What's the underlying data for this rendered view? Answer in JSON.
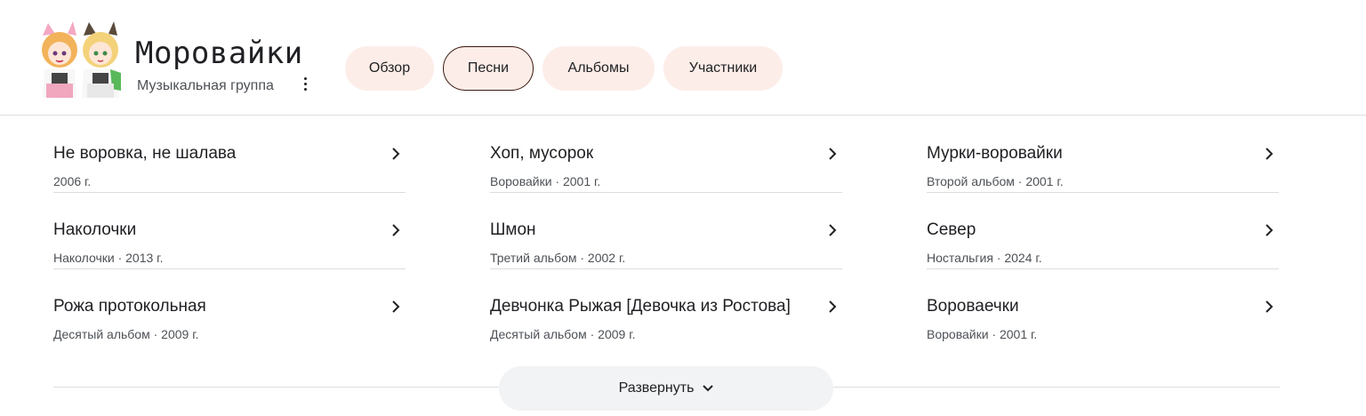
{
  "header": {
    "title": "Моровайки",
    "subtitle": "Музыкальная группа",
    "avatar_icon": "anime-duo-avatar"
  },
  "tabs": [
    {
      "label": "Обзор",
      "active": false
    },
    {
      "label": "Песни",
      "active": true
    },
    {
      "label": "Альбомы",
      "active": false
    },
    {
      "label": "Участники",
      "active": false
    }
  ],
  "songs": [
    {
      "title": "Не воровка, не шалава",
      "subtitle": "2006 г."
    },
    {
      "title": "Хоп, мусорок",
      "subtitle": "Воровайки · 2001 г."
    },
    {
      "title": "Мурки-воровайки",
      "subtitle": "Второй альбом · 2001 г."
    },
    {
      "title": "Наколочки",
      "subtitle": "Наколочки · 2013 г."
    },
    {
      "title": "Шмон",
      "subtitle": "Третий альбом · 2002 г."
    },
    {
      "title": "Север",
      "subtitle": "Ностальгия · 2024 г."
    },
    {
      "title": "Рожа протокольная",
      "subtitle": "Десятый альбом · 2009 г."
    },
    {
      "title": "Девчонка Рыжая [Девочка из Ростова]",
      "subtitle": "Десятый альбом · 2009 г."
    },
    {
      "title": "Вороваечки",
      "subtitle": "Воровайки · 2001 г."
    }
  ],
  "expand_label": "Развернуть",
  "colors": {
    "tab_bg": "#fdede8",
    "tab_active_border": "#3c1a10",
    "expand_bg": "#f1f3f4",
    "divider": "#dadce0"
  }
}
